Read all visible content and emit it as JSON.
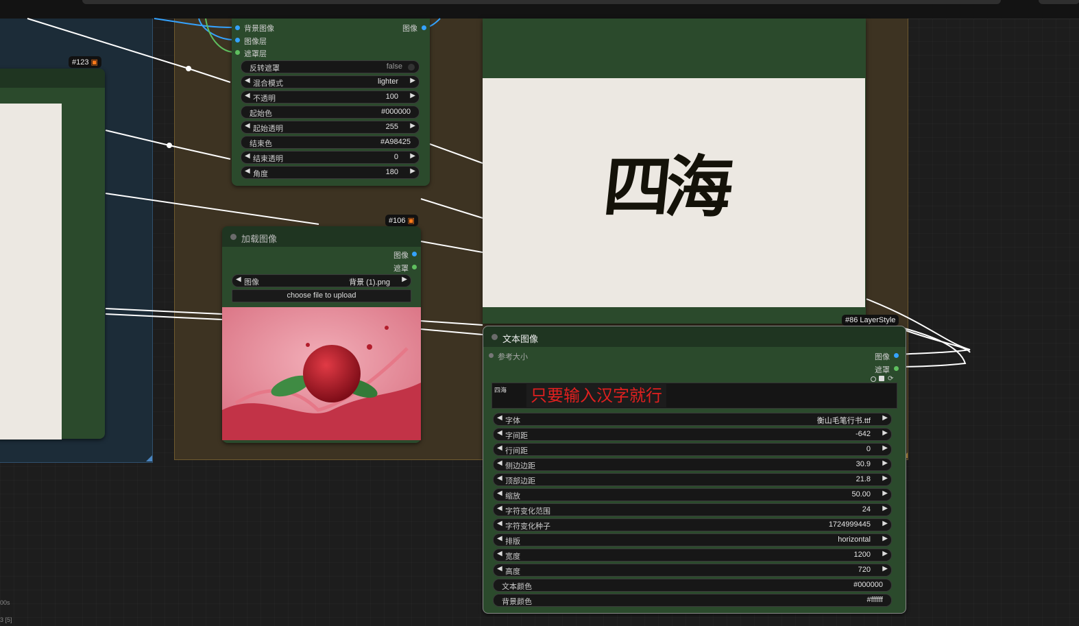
{
  "blend_node": {
    "inputs": [
      "背景图像",
      "图像层",
      "遮罩层"
    ],
    "output": "图像",
    "widgets": [
      {
        "label": "反转遮罩",
        "value": "false",
        "type": "toggle"
      },
      {
        "label": "混合模式",
        "value": "lighter",
        "type": "combo"
      },
      {
        "label": "不透明",
        "value": "100",
        "type": "number"
      },
      {
        "label": "起始色",
        "value": "#000000",
        "type": "text"
      },
      {
        "label": "起始透明",
        "value": "255",
        "type": "number"
      },
      {
        "label": "结束色",
        "value": "#A98425",
        "type": "text"
      },
      {
        "label": "结束透明",
        "value": "0",
        "type": "number"
      },
      {
        "label": "角度",
        "value": "180",
        "type": "number"
      }
    ]
  },
  "left_node": {
    "badge_id": "#123"
  },
  "load_image_node": {
    "badge_id": "#106",
    "title": "加载图像",
    "outputs": [
      "图像",
      "遮罩"
    ],
    "image_label": "图像",
    "image_value": "背景 (1).png",
    "upload_label": "choose file to upload"
  },
  "preview_node": {
    "text": "四海"
  },
  "text_image_node": {
    "badge_id": "#86 LayerStyle",
    "title": "文本图像",
    "input": "参考大小",
    "outputs": [
      "图像",
      "遮罩"
    ],
    "text_value": "四海",
    "annotation": "只要输入汉字就行",
    "widgets": [
      {
        "label": "字体",
        "value": "衡山毛笔行书.ttf",
        "type": "combo"
      },
      {
        "label": "字间距",
        "value": "-642",
        "type": "number"
      },
      {
        "label": "行间距",
        "value": "0",
        "type": "number"
      },
      {
        "label": "侧边边距",
        "value": "30.9",
        "type": "number"
      },
      {
        "label": "顶部边距",
        "value": "21.8",
        "type": "number"
      },
      {
        "label": "缩放",
        "value": "50.00",
        "type": "number"
      },
      {
        "label": "字符变化范围",
        "value": "24",
        "type": "number"
      },
      {
        "label": "字符变化种子",
        "value": "1724999445",
        "type": "number"
      },
      {
        "label": "排版",
        "value": "horizontal",
        "type": "combo"
      },
      {
        "label": "宽度",
        "value": "1200",
        "type": "number"
      },
      {
        "label": "高度",
        "value": "720",
        "type": "number"
      },
      {
        "label": "文本颜色",
        "value": "#000000",
        "type": "text"
      },
      {
        "label": "背景颜色",
        "value": "#ffffff",
        "type": "text"
      }
    ]
  },
  "status": {
    "line1": "00s",
    "line2": "3 [5]"
  },
  "colors": {
    "node_bg": "#2b4a2c",
    "group_brown": "#3d3322",
    "group_blue": "#1c2c38",
    "link_white": "#ffffff",
    "slot_blue": "#35a3ff",
    "slot_green": "#5fbf5f",
    "annotation_red": "#e0201f"
  },
  "icons": [
    "fox-icon",
    "toggle-icon",
    "checkbox-icon",
    "refresh-icon"
  ]
}
